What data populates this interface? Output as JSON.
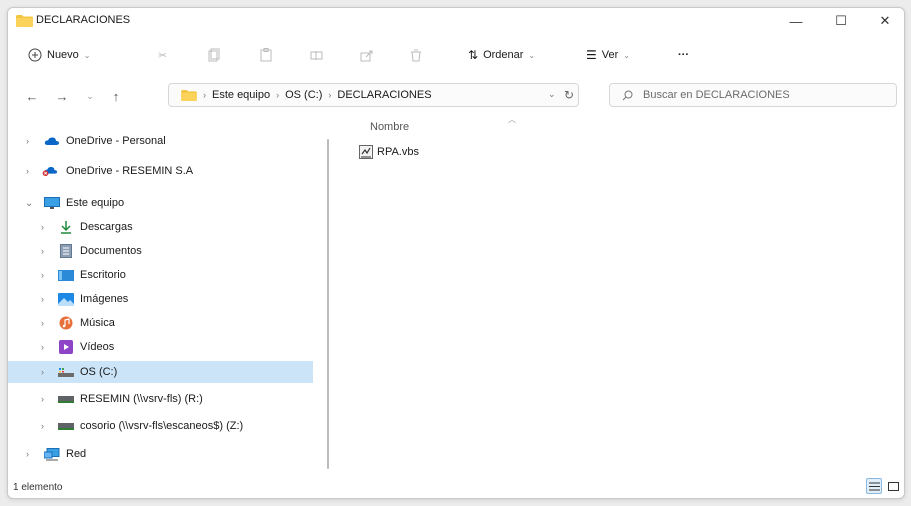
{
  "window": {
    "title": "DECLARACIONES"
  },
  "window_buttons": {
    "minimize": "—",
    "maximize": "☐",
    "close": "✕"
  },
  "toolbar": {
    "new_label": "Nuevo",
    "sort_label": "Ordenar",
    "view_label": "Ver",
    "more_label": "···"
  },
  "address": {
    "crumbs": [
      "Este equipo",
      "OS (C:)",
      "DECLARACIONES"
    ]
  },
  "search": {
    "placeholder": "Buscar en DECLARACIONES"
  },
  "nav": {
    "items": [
      {
        "label": "OneDrive - Personal",
        "icon": "onedrive-icon"
      },
      {
        "label": "OneDrive - RESEMIN S.A",
        "icon": "onedrive-error-icon"
      },
      {
        "label": "Este equipo",
        "icon": "computer-icon"
      },
      {
        "label": "Descargas",
        "icon": "download-icon"
      },
      {
        "label": "Documentos",
        "icon": "document-icon"
      },
      {
        "label": "Escritorio",
        "icon": "desktop-icon"
      },
      {
        "label": "Imágenes",
        "icon": "pictures-icon"
      },
      {
        "label": "Música",
        "icon": "music-icon"
      },
      {
        "label": "Vídeos",
        "icon": "video-icon"
      },
      {
        "label": "OS (C:)",
        "icon": "drive-icon",
        "selected": true
      },
      {
        "label": "RESEMIN (\\\\vsrv-fls) (R:)",
        "icon": "network-drive-icon"
      },
      {
        "label": "cosorio (\\\\vsrv-fls\\escaneos$) (Z:)",
        "icon": "network-drive-icon"
      },
      {
        "label": "Red",
        "icon": "network-icon"
      }
    ]
  },
  "filelist": {
    "column_name": "Nombre",
    "files": [
      {
        "name": "RPA.vbs",
        "icon": "vbs-script-icon"
      }
    ]
  },
  "statusbar": {
    "count": "1 elemento"
  },
  "colors": {
    "selection": "#cce4f7",
    "folder": "#f4c542",
    "accent": "#0067c0"
  }
}
